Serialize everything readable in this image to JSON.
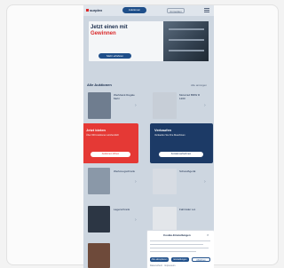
{
  "header": {
    "logo": "surplex",
    "nav_pill": "Auktionen",
    "top_button": "Anmelden",
    "menu_icon": "hamburger-menu-icon"
  },
  "hero": {
    "title": "Jetzt einen mit",
    "subtitle": "Gewinnen",
    "button": "Mehr erfahren"
  },
  "section": {
    "title": "Alle Auktionen",
    "link": "Alle anzeigen"
  },
  "items": [
    {
      "text": "Werkbank Regale Mehr"
    },
    {
      "text": "Motorrad BMW R 1200"
    },
    {
      "text": "Werkzeugschrank"
    },
    {
      "text": "Schweißgerät"
    },
    {
      "text": "Lagerschrank"
    },
    {
      "text": "Fahrräder Lot"
    }
  ],
  "promo_red": {
    "title": "Jetzt bieten",
    "text": "Über 600 Auktionen wöchentlich",
    "button": "Auktionen öffnen",
    "color": "#e53935"
  },
  "promo_blue": {
    "title": "Verkaufen",
    "text": "Verkaufen Sie Ihre Maschinen",
    "button": "Kontakt aufnehmen",
    "color": "#1c3a66"
  },
  "cookie": {
    "title": "Cookie-Einstellungen",
    "btn_accept": "Alle akzeptieren",
    "btn_settings": "Einstellungen",
    "btn_reject": "Ablehnen",
    "footer": "Datenschutz · Impressum"
  }
}
